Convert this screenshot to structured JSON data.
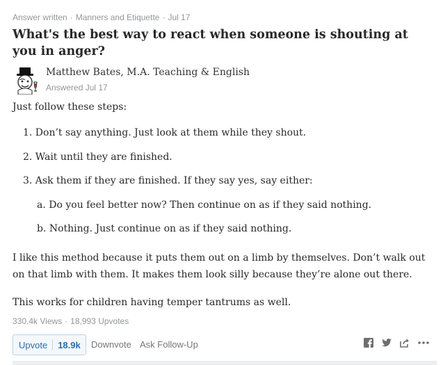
{
  "meta": {
    "kind": "Answer written",
    "topic": "Manners and Etiquette",
    "date": "Jul 17",
    "separator": "·"
  },
  "question": {
    "title": "What's the best way to react when someone is shouting at you in anger?"
  },
  "author": {
    "name": "Matthew Bates, M.A. Teaching & English",
    "answered": "Answered Jul 17",
    "avatar_icon": "top-hat-gentleman-avatar-icon"
  },
  "answer": {
    "intro": "Just follow these steps:",
    "steps": [
      "1. Don’t say anything. Just look at them while they shout.",
      "2. Wait until they are finished.",
      "3. Ask them if they are finished. If they say yes, say either:"
    ],
    "sub_steps": [
      "a. Do you feel better now? Then continue on as if they said nothing.",
      "b. Nothing. Just continue on as if they said nothing."
    ],
    "para1_line1": "I like this method because it puts them out on a limb by themselves. Don’t walk out",
    "para1_line2": "on that limb with them. It makes them look silly because they’re alone out there.",
    "para2": "This works for children having temper tantrums as well."
  },
  "stats": {
    "views": "330.4k Views",
    "upvotes": "18,993 Upvotes",
    "separator": "·"
  },
  "actions": {
    "upvote_label": "Upvote",
    "upvote_count": "18.9k",
    "downvote_label": "Downvote",
    "followup_label": "Ask Follow-Up",
    "icons": [
      "facebook-icon",
      "twitter-icon",
      "share-icon",
      "more-icon"
    ]
  },
  "colors": {
    "muted": "#939598",
    "upvote_blue": "#2b6dad",
    "text": "#282829"
  }
}
